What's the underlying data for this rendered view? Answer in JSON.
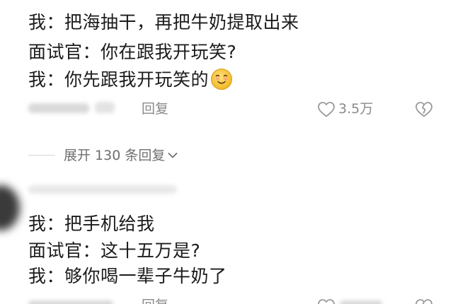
{
  "comment1": {
    "lines": [
      "我：把海抽干，再把牛奶提取出来",
      "面试官：你在跟我开玩笑?",
      "我：你先跟我开玩笑的"
    ],
    "emoji": "blushing-smiley",
    "reply_label": "回复",
    "like_count": "3.5万"
  },
  "expand": {
    "label": "展开 130 条回复"
  },
  "comment2": {
    "lines": [
      "我：把手机给我",
      "面试官：这十五万是?",
      "我：够你喝一辈子牛奶了"
    ],
    "reply_label": "回复"
  },
  "colors": {
    "text": "#1b1b1b",
    "meta": "#8a8a8a",
    "icon": "#9a9a9a",
    "emoji_face": "#f7c23a"
  }
}
